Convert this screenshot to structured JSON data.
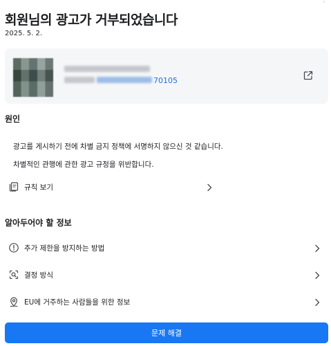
{
  "top_fragment": "›",
  "header": {
    "title": "회원님의 광고가 거부되었습니다",
    "date": "2025. 5. 2."
  },
  "ad": {
    "id_suffix": "70105",
    "link_icon": "external-link-icon"
  },
  "reason_section": {
    "title": "원인",
    "lines": [
      "광고를 게시하기 전에 차별 금지 정책에 서명하지 않으신 것 같습니다.",
      "차별적인 관행에 관한 광고 규정을 위반합니다."
    ],
    "policy_link": {
      "label": "규칙 보기",
      "icon": "policy-cards-icon"
    }
  },
  "info_section": {
    "title": "알아두어야 할 정보",
    "items": [
      {
        "label": "추가 제한을 방지하는 방법",
        "icon": "alert-circle-icon"
      },
      {
        "label": "결정 방식",
        "icon": "review-scan-icon"
      },
      {
        "label": "EU에 거주하는 사람들을 위한 정보",
        "icon": "location-pin-icon"
      }
    ]
  },
  "action": {
    "label": "문제 해결"
  },
  "colors": {
    "accent": "#1877f2",
    "link": "#216fdb",
    "card_bg": "#f5f6f7",
    "text": "#1c1e21"
  }
}
